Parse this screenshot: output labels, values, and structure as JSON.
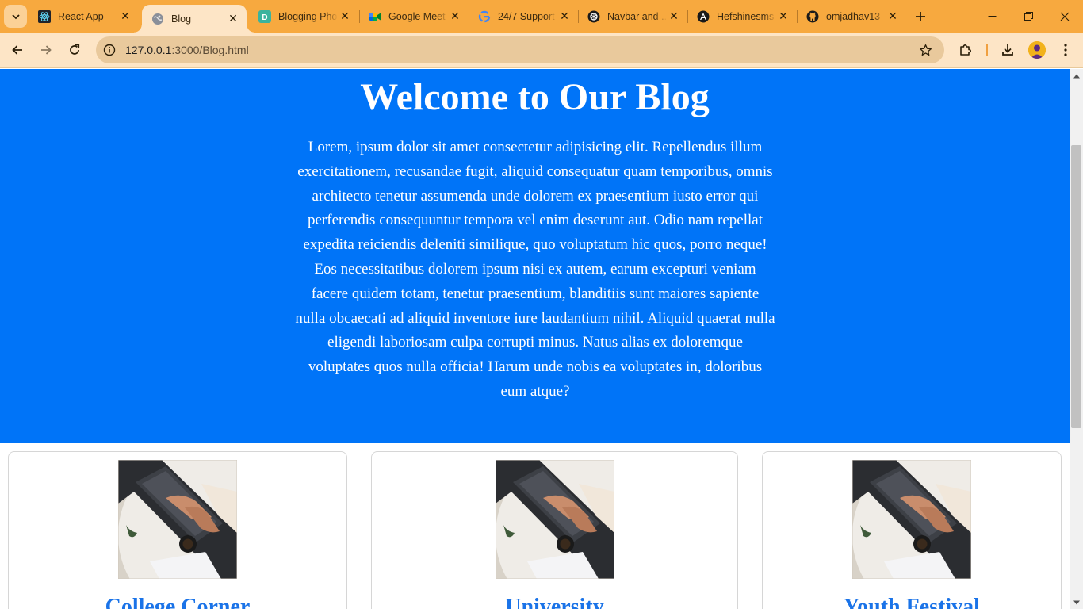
{
  "browser": {
    "tabs": [
      {
        "title": "React App",
        "icon": "react-icon",
        "active": false
      },
      {
        "title": "Blog",
        "icon": "globe-icon",
        "active": true
      },
      {
        "title": "Blogging Phones",
        "icon": "dashboard-icon",
        "active": false
      },
      {
        "title": "Google Meet",
        "icon": "google-meet-icon",
        "active": false
      },
      {
        "title": "24/7 Support",
        "icon": "google-icon",
        "active": false
      },
      {
        "title": "Navbar and ...",
        "icon": "openai-icon",
        "active": false
      },
      {
        "title": "Hefshinesms",
        "icon": "angular-icon",
        "active": false
      },
      {
        "title": "omjadhav13",
        "icon": "github-icon",
        "active": false
      }
    ],
    "address": {
      "host": "127.0.0.1",
      "path": ":3000/Blog.html"
    },
    "colors": {
      "tab_strip": "#f7a93f",
      "toolbar": "#fde5c6",
      "omnibox": "#e9c99c"
    }
  },
  "page": {
    "hero": {
      "title": "Welcome to Our Blog",
      "body": "Lorem, ipsum dolor sit amet consectetur adipisicing elit. Repellendus illum exercitationem, recusandae fugit, aliquid consequatur quam temporibus, omnis architecto tenetur assumenda unde dolorem ex praesentium iusto error qui perferendis consequuntur tempora vel enim deserunt aut. Odio nam repellat expedita reiciendis deleniti similique, quo voluptatum hic quos, porro neque! Eos necessitatibus dolorem ipsum nisi ex autem, earum excepturi veniam facere quidem totam, tenetur praesentium, blanditiis sunt maiores sapiente nulla obcaecati ad aliquid inventore iure laudantium nihil. Aliquid quaerat nulla eligendi laboriosam culpa corrupti minus. Natus alias ex doloremque voluptates quos nulla officia! Harum unde nobis ea voluptates in, doloribus eum atque?",
      "background": "#0074f8"
    },
    "cards": [
      {
        "title": "College Corner",
        "image": "laptop-desk-photo"
      },
      {
        "title": "University",
        "image": "laptop-desk-photo"
      },
      {
        "title": "Youth Festival",
        "image": "laptop-desk-photo"
      }
    ]
  }
}
